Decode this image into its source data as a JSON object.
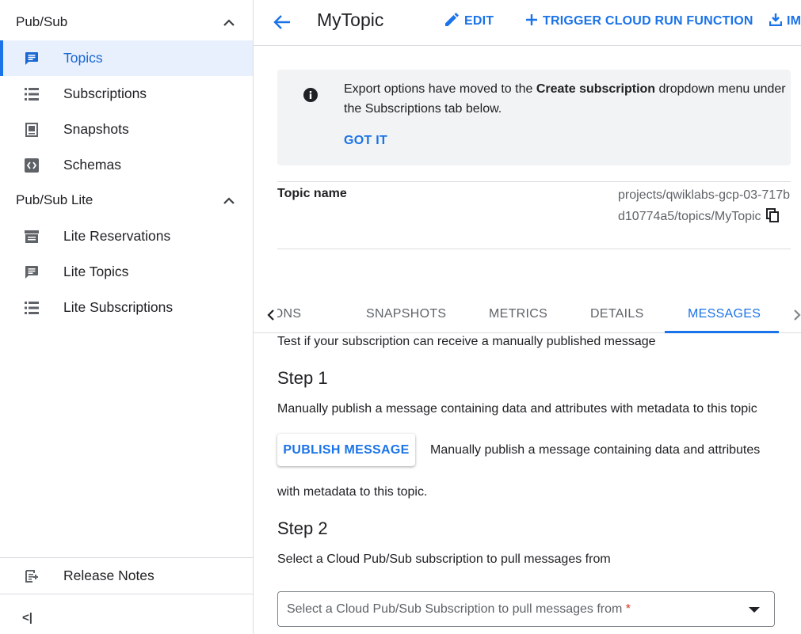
{
  "sidebar": {
    "pubsub_label": "Pub/Sub",
    "pubsub_items": [
      {
        "label": "Topics",
        "icon": "topic-icon"
      },
      {
        "label": "Subscriptions",
        "icon": "list-icon"
      },
      {
        "label": "Snapshots",
        "icon": "snapshot-icon"
      },
      {
        "label": "Schemas",
        "icon": "schema-icon"
      }
    ],
    "lite_label": "Pub/Sub Lite",
    "lite_items": [
      {
        "label": "Lite Reservations",
        "icon": "reservation-icon"
      },
      {
        "label": "Lite Topics",
        "icon": "topic-icon"
      },
      {
        "label": "Lite Subscriptions",
        "icon": "list-icon"
      }
    ],
    "release_notes": "Release Notes",
    "collapse_glyph": "<|"
  },
  "header": {
    "title": "MyTopic",
    "edit": "EDIT",
    "trigger": "TRIGGER CLOUD RUN FUNCTION",
    "import": "IM"
  },
  "banner": {
    "text_before": "Export options have moved to the ",
    "text_bold": "Create subscription",
    "text_after": " dropdown menu under the Subscriptions tab below.",
    "action": "GOT IT"
  },
  "topic": {
    "key": "Topic name",
    "value": "projects/qwiklabs-gcp-03-717bd10774a5/topics/MyTopic"
  },
  "tabs": {
    "items": [
      "IONS",
      "SNAPSHOTS",
      "METRICS",
      "DETAILS",
      "MESSAGES"
    ],
    "active": "MESSAGES"
  },
  "messages": {
    "intro": "Test if your subscription can receive a manually published message",
    "step1_title": "Step 1",
    "step1_desc": "Manually publish a message containing data and attributes with metadata to this topic",
    "publish_button": "PUBLISH MESSAGE",
    "publish_hint_line1": "Manually publish a message containing data and attributes",
    "publish_hint_line2": "with metadata to this topic.",
    "step2_title": "Step 2",
    "step2_desc": "Select a Cloud Pub/Sub subscription to pull messages from",
    "select_placeholder": "Select a Cloud Pub/Sub Subscription to pull messages from",
    "select_required": "*"
  },
  "colors": {
    "accent": "#1a73e8",
    "active_bg": "#e8f0fe",
    "banner_bg": "#f1f3f4",
    "required": "#d93025"
  }
}
